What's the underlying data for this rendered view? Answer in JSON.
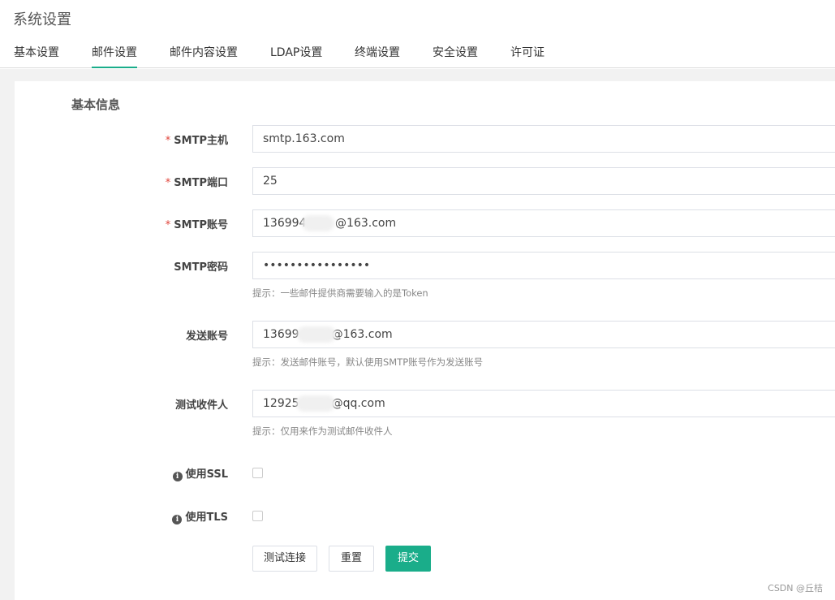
{
  "page_title": "系统设置",
  "tabs": [
    {
      "label": "基本设置",
      "active": false
    },
    {
      "label": "邮件设置",
      "active": true
    },
    {
      "label": "邮件内容设置",
      "active": false
    },
    {
      "label": "LDAP设置",
      "active": false
    },
    {
      "label": "终端设置",
      "active": false
    },
    {
      "label": "安全设置",
      "active": false
    },
    {
      "label": "许可证",
      "active": false
    }
  ],
  "section_title": "基本信息",
  "form": {
    "smtp_host": {
      "label": "SMTP主机",
      "required": "*",
      "value": "smtp.163.com"
    },
    "smtp_port": {
      "label": "SMTP端口",
      "required": "*",
      "value": "25"
    },
    "smtp_account": {
      "label": "SMTP账号",
      "required": "*",
      "value": "136994        @163.com"
    },
    "smtp_password": {
      "label": "SMTP密码",
      "value": "••••••••••••••••",
      "hint": "提示：一些邮件提供商需要输入的是Token"
    },
    "send_account": {
      "label": "发送账号",
      "value": "13699         @163.com",
      "hint": "提示：发送邮件账号，默认使用SMTP账号作为发送账号"
    },
    "test_recipient": {
      "label": "测试收件人",
      "value": "12925         @qq.com",
      "hint": "提示：仅用来作为测试邮件收件人"
    },
    "use_ssl": {
      "label": "使用SSL",
      "checked": false
    },
    "use_tls": {
      "label": "使用TLS",
      "checked": false
    }
  },
  "buttons": {
    "test": "测试连接",
    "reset": "重置",
    "submit": "提交"
  },
  "info_icon_glyph": "i",
  "watermark": "CSDN @丘桔",
  "colors": {
    "accent": "#1aad8a",
    "required": "#e0443a"
  }
}
